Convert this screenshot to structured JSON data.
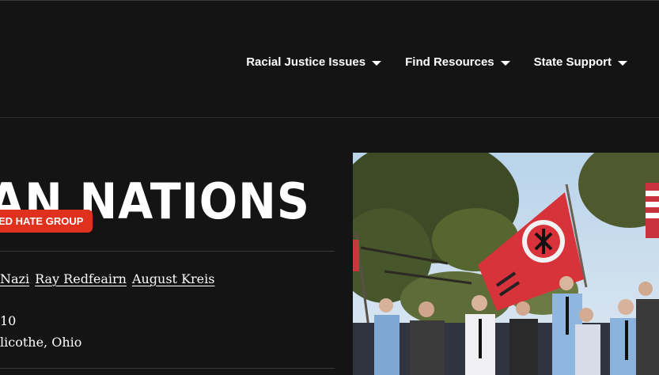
{
  "nav": {
    "items": [
      {
        "label": "Racial Justice Issues"
      },
      {
        "label": "Find Resources"
      },
      {
        "label": "State Support"
      }
    ]
  },
  "group": {
    "title": "AN NATIONS",
    "badge": "ED HATE GROUP",
    "leaders": [
      "Nazi",
      "Ray Redfeairn",
      "August Kreis"
    ],
    "founded": "10",
    "location": "licothe, Ohio"
  },
  "colors": {
    "background": "#141414",
    "badge": "#e0301e",
    "flag": "#d8323a"
  }
}
